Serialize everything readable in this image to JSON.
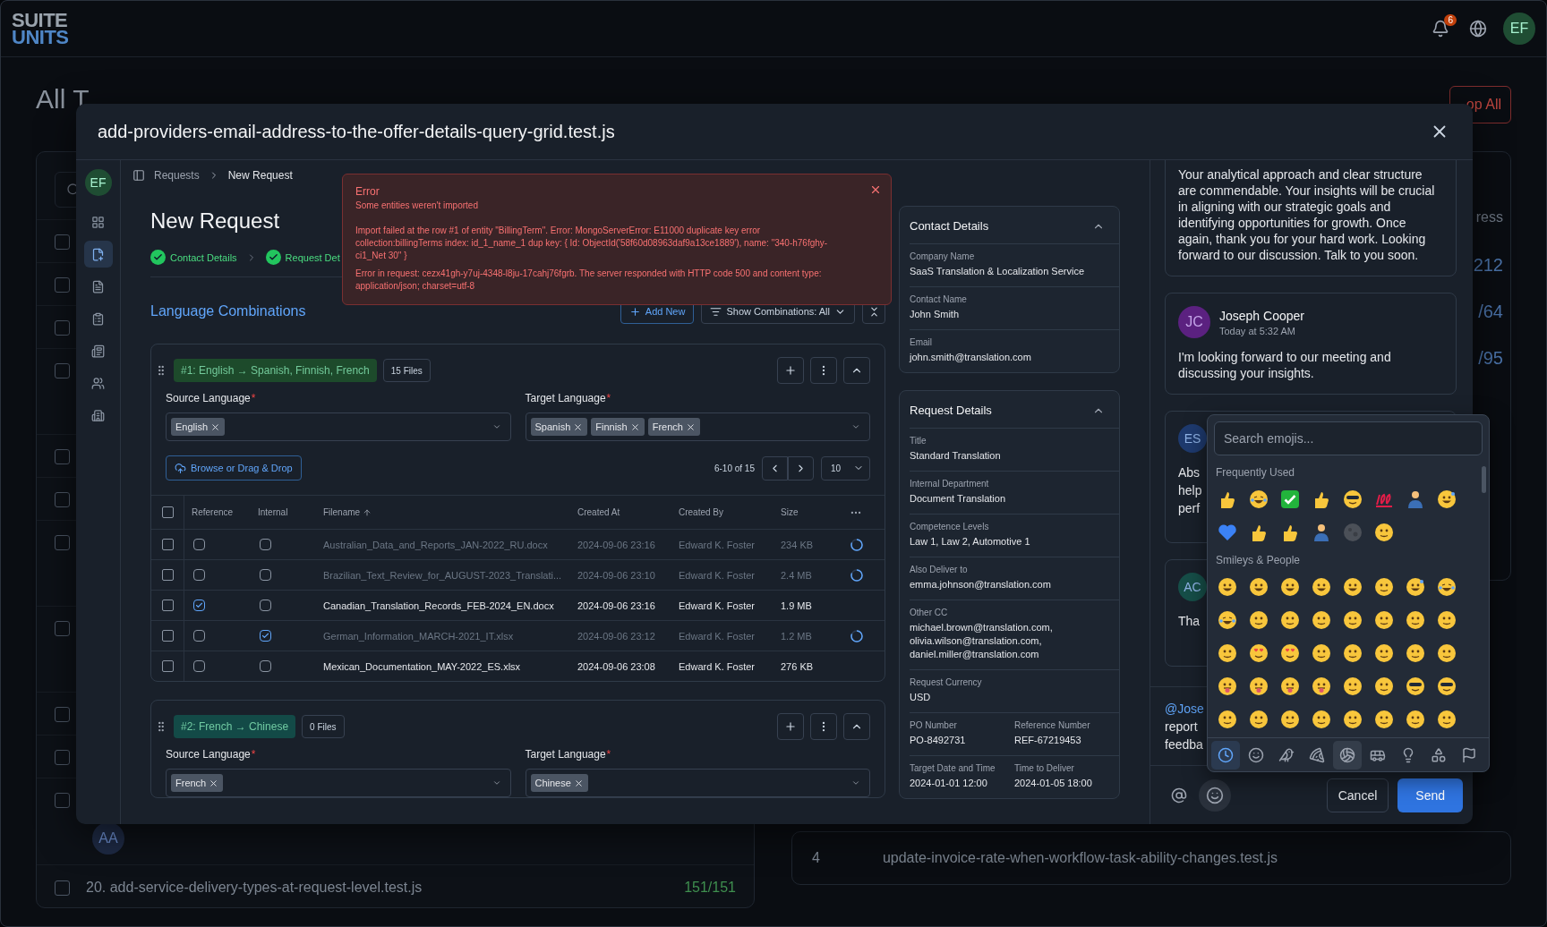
{
  "top_bar": {
    "logo_top": "SUITE",
    "logo_bottom": "UNITS",
    "notification_count": "6",
    "avatar": "EF"
  },
  "background": {
    "title": "All T",
    "stop_button": "op All",
    "progress_header": "ress",
    "progress_values": [
      "212",
      "/64",
      "/95"
    ],
    "rows": [
      {
        "kind": "single",
        "checked": false
      },
      {
        "kind": "single",
        "checked": false
      },
      {
        "kind": "single",
        "checked": false
      },
      {
        "kind": "double",
        "checked": false
      },
      {
        "kind": "single",
        "checked": false
      },
      {
        "kind": "single",
        "checked": false
      },
      {
        "kind": "double",
        "checked": false
      },
      {
        "kind": "double",
        "checked": false
      },
      {
        "kind": "single",
        "checked": false
      },
      {
        "kind": "single",
        "checked": false
      },
      {
        "kind": "assigned",
        "checked": false,
        "avatar": "AA"
      },
      {
        "kind": "named",
        "checked": false,
        "name": "20. add-service-delivery-types-at-request-level.test.js",
        "progress": "151/151"
      }
    ],
    "right_row": {
      "index": "4",
      "name": "update-invoice-rate-when-workflow-task-ability-changes.test.js"
    }
  },
  "modal": {
    "title": "add-providers-email-address-to-the-offer-details-query-grid.test.js"
  },
  "rail": {
    "avatar": "EF",
    "items": [
      {
        "kind": "grid",
        "selected": false
      },
      {
        "kind": "request",
        "selected": true
      },
      {
        "kind": "document",
        "selected": false
      },
      {
        "kind": "clipboard",
        "selected": false
      },
      {
        "kind": "list",
        "selected": false
      },
      {
        "kind": "users",
        "selected": false
      },
      {
        "kind": "building",
        "selected": false
      }
    ]
  },
  "breadcrumb": [
    "Requests",
    "New Request"
  ],
  "page_title": "New Request",
  "steps": [
    {
      "label": "Contact Details",
      "done": true
    },
    {
      "label": "Request Det",
      "done": true
    }
  ],
  "error": {
    "title": "Error",
    "subtitle": "Some entities weren't imported",
    "messages": [
      "Import failed at the row #1 of entity \"BillingTerm\". Error: MongoServerError: E11000 duplicate key error collection:billingTerms index: id_1_name_1 dup key: { Id: ObjectId('58f60d08963daf9a13ce1889'), name: \"340-h76fghy-ci1_Net 30\" }",
      "Error in request: cezx41gh-y7uj-4348-l8ju-17cahj76fgrb. The server responded with HTTP code 500 and content type: application/json; charset=utf-8"
    ]
  },
  "section_title": "Language Combinations",
  "add_button": "Add New",
  "filter_button": "Show Combinations: All",
  "combinations": [
    {
      "tag": "#1: English → Spanish, Finnish, French",
      "color": "#1d4a2b",
      "files": "15 Files",
      "source_label": "Source Language",
      "target_label": "Target Language",
      "required_mark": "*",
      "source": [
        "English"
      ],
      "targets": [
        "Spanish",
        "Finnish",
        "French"
      ],
      "browse": "Browse or Drag & Drop",
      "range": "6-10 of 15",
      "page_size": "10",
      "all_selected": false,
      "columns": [
        "Reference",
        "Internal",
        "Filename",
        "Created At",
        "Created By",
        "Size"
      ],
      "rows": [
        {
          "selected": false,
          "reference": false,
          "internal": false,
          "disabled": true,
          "filename": "Australian_Data_and_Reports_JAN-2022_RU.docx",
          "created_at": "2024-09-06 23:16",
          "created_by": "Edward K. Foster",
          "size": "234 KB"
        },
        {
          "selected": false,
          "reference": false,
          "internal": false,
          "disabled": true,
          "filename": "Brazilian_Text_Review_for_AUGUST-2023_Translati...",
          "created_at": "2024-09-06 23:10",
          "created_by": "Edward K. Foster",
          "size": "2.4 MB"
        },
        {
          "selected": false,
          "reference": true,
          "internal": false,
          "disabled": false,
          "filename": "Canadian_Translation_Records_FEB-2024_EN.docx",
          "created_at": "2024-09-06 23:16",
          "created_by": "Edward K. Foster",
          "size": "1.9 MB"
        },
        {
          "selected": false,
          "reference": false,
          "internal": true,
          "disabled": true,
          "filename": "German_Information_MARCH-2021_IT.xlsx",
          "created_at": "2024-09-06 23:12",
          "created_by": "Edward K. Foster",
          "size": "1.2 MB"
        },
        {
          "selected": false,
          "reference": false,
          "internal": false,
          "disabled": false,
          "filename": "Mexican_Documentation_MAY-2022_ES.xlsx",
          "created_at": "2024-09-06 23:08",
          "created_by": "Edward K. Foster",
          "size": "276 KB"
        }
      ]
    },
    {
      "tag": "#2: French → Chinese",
      "color": "#134a47",
      "files": "0 Files",
      "source_label": "Source Language",
      "target_label": "Target Language",
      "required_mark": "*",
      "source": [
        "French"
      ],
      "targets": [
        "Chinese"
      ]
    }
  ],
  "details": [
    {
      "title": "Contact Details",
      "expanded": true,
      "rows": [
        {
          "fields": [
            {
              "label": "Company Name",
              "value": "SaaS Translation & Localization Service"
            }
          ]
        },
        {
          "fields": [
            {
              "label": "Contact Name",
              "value": "John Smith"
            }
          ]
        },
        {
          "fields": [
            {
              "label": "Email",
              "value": "john.smith@translation.com"
            }
          ]
        }
      ]
    },
    {
      "title": "Request Details",
      "expanded": true,
      "rows": [
        {
          "fields": [
            {
              "label": "Title",
              "value": "Standard Translation"
            }
          ]
        },
        {
          "fields": [
            {
              "label": "Internal Department",
              "value": "Document Translation"
            }
          ]
        },
        {
          "fields": [
            {
              "label": "Competence Levels",
              "value": "Law 1, Law 2, Automotive 1"
            }
          ]
        },
        {
          "fields": [
            {
              "label": "Also Deliver to",
              "value": "emma.johnson@translation.com"
            }
          ]
        },
        {
          "fields": [
            {
              "label": "Other CC",
              "value": "michael.brown@translation.com, olivia.wilson@translation.com, daniel.miller@translation.com"
            }
          ]
        },
        {
          "fields": [
            {
              "label": "Request Currency",
              "value": "USD"
            }
          ]
        },
        {
          "fields": [
            {
              "label": "PO Number",
              "value": "PO-8492731"
            },
            {
              "label": "Reference Number",
              "value": "REF-67219453"
            }
          ]
        },
        {
          "fields": [
            {
              "label": "Target Date and Time",
              "value": "2024-01-01 12:00"
            },
            {
              "label": "Time to Deliver",
              "value": "2024-01-05 18:00"
            }
          ]
        }
      ]
    }
  ],
  "messages": [
    {
      "kind": "body",
      "text": "Your analytical approach and clear structure are commendable. Your insights will be crucial in aligning with our strategic goals and identifying opportunities for growth. Once again, thank you for your hard work. Looking forward to our discussion. Talk to you soon."
    },
    {
      "kind": "full",
      "initials": "JC",
      "color": "#5b2180",
      "author": "Joseph Cooper",
      "time": "Today at 5:32 AM",
      "text": "I'm looking forward to our meeting and discussing your insights."
    },
    {
      "kind": "covered",
      "initials": "ES",
      "color": "#1e3a6e",
      "lines": [
        "Abs",
        "help",
        "perf"
      ]
    },
    {
      "kind": "covered",
      "initials": "AC",
      "color": "#164e48",
      "lines": [
        "Tha"
      ]
    }
  ],
  "draft": {
    "mention": "@Jose",
    "lines": [
      "report",
      "feedba"
    ]
  },
  "cancel": "Cancel",
  "send": "Send",
  "emoji_picker": {
    "placeholder": "Search emojis...",
    "groups": [
      {
        "title": "Frequently Used",
        "items": [
          {
            "kind": "thumb"
          },
          {
            "kind": "laugh"
          },
          {
            "kind": "check"
          },
          {
            "kind": "clap"
          },
          {
            "kind": "cool"
          },
          {
            "kind": "hundred"
          },
          {
            "kind": "person"
          },
          {
            "kind": "sweat"
          },
          {
            "kind": "heart"
          },
          {
            "kind": "pray"
          },
          {
            "kind": "write"
          },
          {
            "kind": "person"
          },
          {
            "kind": "moon"
          },
          {
            "kind": "face"
          }
        ]
      },
      {
        "title": "Smileys & People",
        "items": [
          {
            "kind": "grin"
          },
          {
            "kind": "grin"
          },
          {
            "kind": "grin"
          },
          {
            "kind": "grin"
          },
          {
            "kind": "grin"
          },
          {
            "kind": "face"
          },
          {
            "kind": "sweat"
          },
          {
            "kind": "laugh"
          },
          {
            "kind": "laugh"
          },
          {
            "kind": "face"
          },
          {
            "kind": "face"
          },
          {
            "kind": "face"
          },
          {
            "kind": "face"
          },
          {
            "kind": "face"
          },
          {
            "kind": "face"
          },
          {
            "kind": "face"
          },
          {
            "kind": "face"
          },
          {
            "kind": "love"
          },
          {
            "kind": "love"
          },
          {
            "kind": "face"
          },
          {
            "kind": "face"
          },
          {
            "kind": "face"
          },
          {
            "kind": "face"
          },
          {
            "kind": "face"
          },
          {
            "kind": "tongue"
          },
          {
            "kind": "tongue"
          },
          {
            "kind": "tongue"
          },
          {
            "kind": "tongue"
          },
          {
            "kind": "face"
          },
          {
            "kind": "face"
          },
          {
            "kind": "cool"
          },
          {
            "kind": "cool"
          },
          {
            "kind": "face"
          },
          {
            "kind": "face"
          },
          {
            "kind": "face"
          },
          {
            "kind": "face"
          },
          {
            "kind": "face"
          },
          {
            "kind": "face"
          },
          {
            "kind": "face"
          },
          {
            "kind": "face"
          }
        ]
      }
    ],
    "categories": [
      {
        "kind": "clock",
        "selected": true,
        "hovered": false
      },
      {
        "kind": "smile",
        "selected": false,
        "hovered": false
      },
      {
        "kind": "animal",
        "selected": false,
        "hovered": false
      },
      {
        "kind": "food",
        "selected": false,
        "hovered": false
      },
      {
        "kind": "ball",
        "selected": false,
        "hovered": true
      },
      {
        "kind": "bus",
        "selected": false,
        "hovered": false
      },
      {
        "kind": "bulb",
        "selected": false,
        "hovered": false
      },
      {
        "kind": "symbols",
        "selected": false,
        "hovered": false
      },
      {
        "kind": "flag",
        "selected": false,
        "hovered": false
      }
    ]
  }
}
